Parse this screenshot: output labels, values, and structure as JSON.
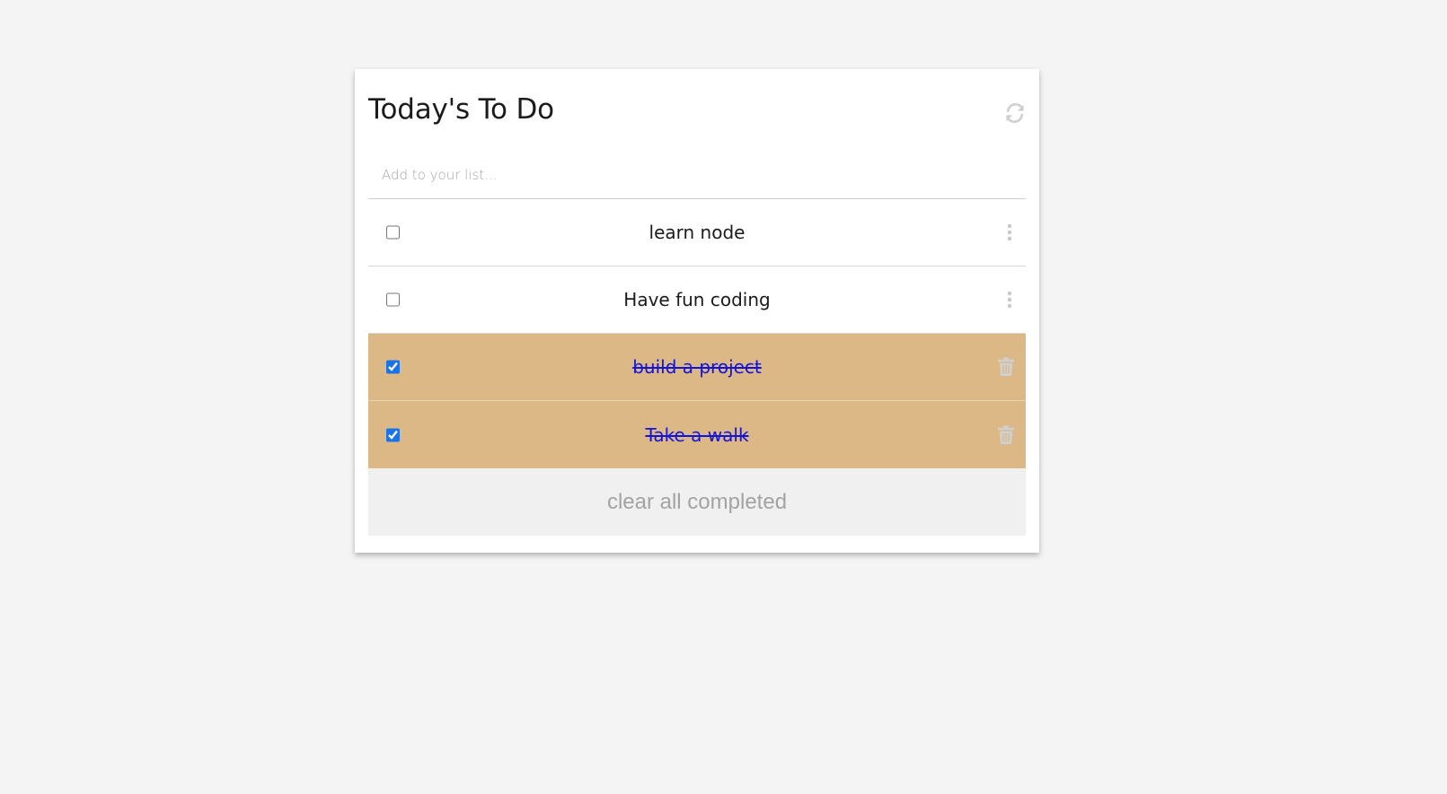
{
  "app": {
    "title": "Today's To Do",
    "refresh_icon": "refresh-icon"
  },
  "input": {
    "placeholder": "Add to your list...",
    "value": ""
  },
  "todos": [
    {
      "text": "learn node",
      "completed": false,
      "action_icon": "more-vertical-icon"
    },
    {
      "text": "Have fun coding",
      "completed": false,
      "action_icon": "more-vertical-icon"
    },
    {
      "text": "build a project",
      "completed": true,
      "action_icon": "trash-icon"
    },
    {
      "text": "Take a walk",
      "completed": true,
      "action_icon": "trash-icon"
    }
  ],
  "footer": {
    "clear_label": "clear all completed"
  },
  "colors": {
    "background": "#f4f4f4",
    "card": "#ffffff",
    "completed_row": "#ddb887",
    "completed_text": "#1414d8",
    "icon_gray": "#c8c8c8",
    "clear_button_bg": "#f0f0f0",
    "clear_button_text": "#a3a3a3"
  }
}
